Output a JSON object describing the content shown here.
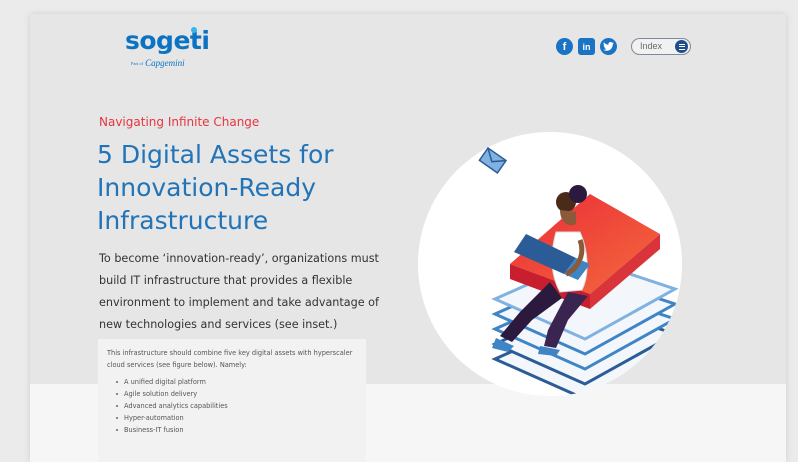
{
  "header": {
    "logo": {
      "wordmark": "sogeti",
      "tagline_prefix": "Part of",
      "tagline_brand": "Capgemini"
    },
    "social": [
      {
        "name": "facebook-icon",
        "glyph": "f"
      },
      {
        "name": "linkedin-icon",
        "glyph": "in"
      },
      {
        "name": "twitter-icon",
        "glyph": "t"
      }
    ],
    "index_toggle": {
      "label": "Index"
    }
  },
  "hero": {
    "eyebrow": "Navigating Infinite Change",
    "title_lines": [
      "5 Digital Assets for",
      "Innovation-Ready",
      "Infrastructure"
    ],
    "lead": "To become ‘innovation-ready’, organizations must build IT infrastructure that provides a flexible environment to implement and take advantage of new technologies and services (see inset.)"
  },
  "inset": {
    "intro": "This infrastructure should combine five key digital assets with hyperscaler cloud services (see figure below). Namely:",
    "items": [
      "A unified digital platform",
      "Agile solution delivery",
      "Advanced analytics capabilities",
      "Hyper-automation",
      "Business-IT fusion"
    ]
  },
  "colors": {
    "brand_blue": "#2174b8",
    "accent_red": "#e5353f",
    "icon_blue": "#1a73c3"
  }
}
